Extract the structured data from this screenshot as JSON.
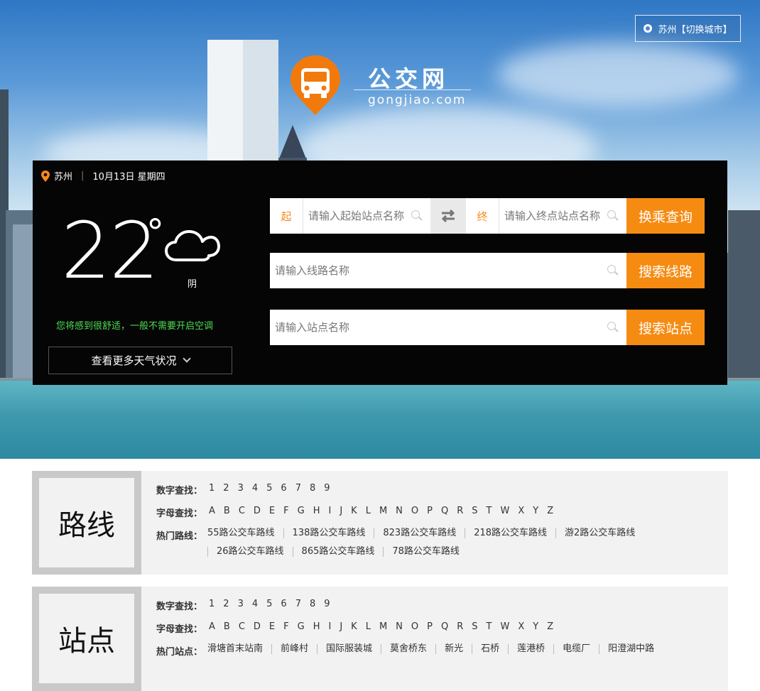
{
  "header": {
    "city": "苏州",
    "switch_label": "【切换城市】",
    "logo_title": "公交网",
    "logo_sub": "gongjiao.com"
  },
  "weather": {
    "city": "苏州",
    "date": "10月13日 星期四",
    "temperature": "22",
    "degree": "°",
    "condition": "阴",
    "tip": "您将感到很舒适，一般不需要开启空调",
    "more_label": "查看更多天气状况"
  },
  "transfer": {
    "start_tag": "起",
    "start_placeholder": "请输入起始站点名称",
    "end_tag": "终",
    "end_placeholder": "请输入终点站点名称",
    "button": "换乘查询"
  },
  "line_search": {
    "placeholder": "请输入线路名称",
    "button": "搜索线路"
  },
  "stop_search": {
    "placeholder": "请输入站点名称",
    "button": "搜索站点"
  },
  "routes": {
    "title": "路线",
    "digit_label": "数字查找：",
    "letter_label": "字母查找：",
    "hot_label": "热门路线：",
    "digits": [
      "1",
      "2",
      "3",
      "4",
      "5",
      "6",
      "7",
      "8",
      "9"
    ],
    "letters": [
      "A",
      "B",
      "C",
      "D",
      "E",
      "F",
      "G",
      "H",
      "I",
      "J",
      "K",
      "L",
      "M",
      "N",
      "O",
      "P",
      "Q",
      "R",
      "S",
      "T",
      "W",
      "X",
      "Y",
      "Z"
    ],
    "hot": [
      "55路公交车路线",
      "138路公交车路线",
      "823路公交车路线",
      "218路公交车路线",
      "游2路公交车路线",
      "26路公交车路线",
      "865路公交车路线",
      "78路公交车路线"
    ]
  },
  "stops": {
    "title": "站点",
    "digit_label": "数字查找：",
    "letter_label": "字母查找：",
    "hot_label": "热门站点：",
    "digits": [
      "1",
      "2",
      "3",
      "4",
      "5",
      "6",
      "7",
      "8",
      "9"
    ],
    "letters": [
      "A",
      "B",
      "C",
      "D",
      "E",
      "F",
      "G",
      "H",
      "I",
      "J",
      "K",
      "L",
      "M",
      "N",
      "O",
      "P",
      "Q",
      "R",
      "S",
      "T",
      "W",
      "X",
      "Y",
      "Z"
    ],
    "hot": [
      "滑塘首末站南",
      "前峰村",
      "国际服装城",
      "莫舍桥东",
      "新光",
      "石桥",
      "莲港桥",
      "电缆厂",
      "阳澄湖中路"
    ]
  },
  "colors": {
    "accent": "#f68b12",
    "tip": "#4dde52",
    "panel": "#050505"
  }
}
